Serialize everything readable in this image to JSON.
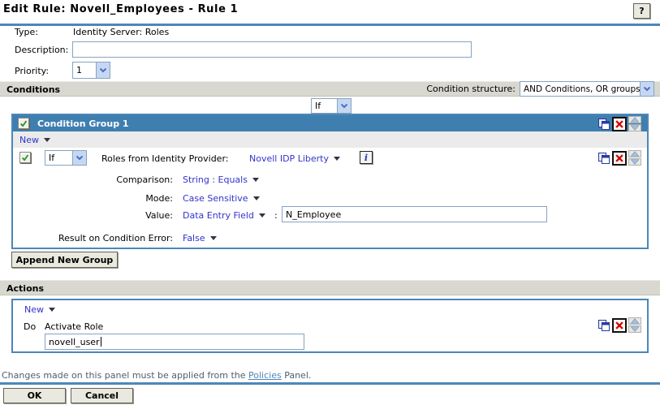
{
  "window": {
    "title": "Edit Rule: Novell_Employees - Rule 1",
    "help_label": "?"
  },
  "form": {
    "type_label": "Type:",
    "type_value": "Identity Server: Roles",
    "description_label": "Description:",
    "description_value": "",
    "priority_label": "Priority:",
    "priority_value": "1"
  },
  "conditions": {
    "section_label": "Conditions",
    "structure_label": "Condition structure:",
    "structure_value": "AND Conditions, OR groups",
    "top_if_value": "If",
    "group": {
      "title": "Condition Group 1",
      "new_label": "New",
      "if_value": "If",
      "roles_label": "Roles from Identity Provider:",
      "provider_value": "Novell IDP Liberty",
      "comparison_label": "Comparison:",
      "comparison_value": "String : Equals",
      "mode_label": "Mode:",
      "mode_value": "Case Sensitive",
      "value_label": "Value:",
      "value_type": "Data Entry Field",
      "value_separator": ":",
      "value_text": "N_Employee",
      "result_label": "Result on Condition Error:",
      "result_value": "False"
    },
    "append_button": "Append New Group"
  },
  "actions": {
    "section_label": "Actions",
    "new_label": "New",
    "do_label": "Do",
    "action_name": "Activate Role",
    "action_value": "novell_user"
  },
  "footer": {
    "note_prefix": "Changes made on this panel must be applied from the ",
    "policies_link": "Policies",
    "note_suffix": " Panel.",
    "ok_button": "OK",
    "cancel_button": "Cancel"
  },
  "colors": {
    "header_blue": "#3f7fb0",
    "border_blue": "#4d86b8",
    "rule_blue": "#4e87b8",
    "link_blue": "#3333cc",
    "bar_gray": "#d8d8d0",
    "delete_red": "#d60000",
    "check_green": "#2f9230"
  }
}
